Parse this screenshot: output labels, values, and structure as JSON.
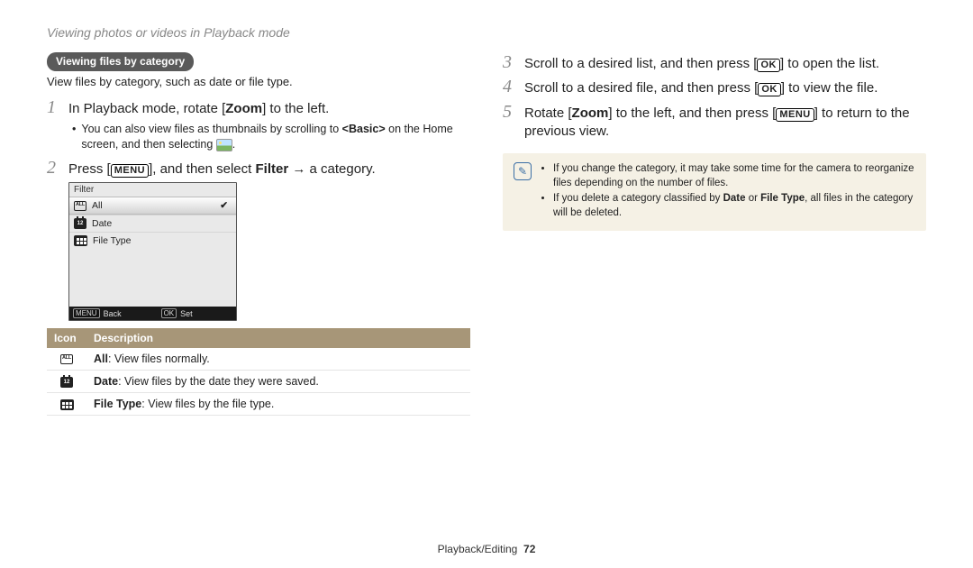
{
  "page_header": "Viewing photos or videos in Playback mode",
  "section_tag": "Viewing files by category",
  "intro": "View files by category, such as date or file type.",
  "steps": [
    {
      "num": "1",
      "pre": "In Playback mode, rotate [",
      "bold1": "Zoom",
      "post": "] to the left.",
      "sub_pre": "You can also view files as thumbnails by scrolling to ",
      "sub_bold": "<Basic>",
      "sub_mid": " on the Home screen, and then selecting ",
      "sub_post": "."
    },
    {
      "num": "2",
      "pre": "Press [",
      "button": "MENU",
      "mid": "], and then select ",
      "bold1": "Filter",
      "post": " → a category."
    }
  ],
  "right_steps": [
    {
      "num": "3",
      "pre": "Scroll to a desired list, and then press [",
      "button": "OK",
      "post": "] to open the list."
    },
    {
      "num": "4",
      "pre": "Scroll to a desired file, and then press [",
      "button": "OK",
      "post": "] to view the file."
    },
    {
      "num": "5",
      "pre": "Rotate [",
      "bold1": "Zoom",
      "mid": "] to the left, and then press [",
      "button": "MENU",
      "post": "] to return to the previous view."
    }
  ],
  "shot": {
    "title": "Filter",
    "rows": [
      {
        "label": "All",
        "selected": true
      },
      {
        "label": "Date",
        "selected": false
      },
      {
        "label": "File Type",
        "selected": false
      }
    ],
    "footer_menu": "MENU",
    "footer_back": "Back",
    "footer_ok": "OK",
    "footer_set": "Set"
  },
  "table": {
    "h_icon": "Icon",
    "h_desc": "Description",
    "rows": [
      {
        "bold": "All",
        "rest": ": View files normally."
      },
      {
        "bold": "Date",
        "rest": ": View files by the date they were saved."
      },
      {
        "bold": "File Type",
        "rest": ": View files by the file type."
      }
    ]
  },
  "note": {
    "items": [
      "If you change the category, it may take some time for the camera to reorganize files depending on the number of files.",
      {
        "pre": "If you delete a category classified by ",
        "b1": "Date",
        "mid": " or ",
        "b2": "File Type",
        "post": ", all files in the category will be deleted."
      }
    ]
  },
  "footer": {
    "section": "Playback/Editing",
    "page": "72"
  }
}
